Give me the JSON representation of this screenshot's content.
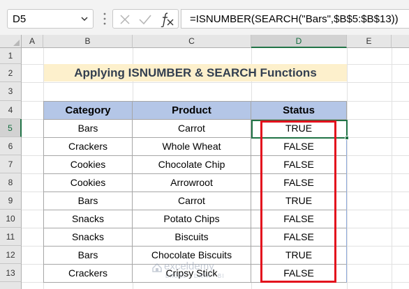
{
  "name_box": {
    "value": "D5"
  },
  "formula_bar": {
    "formula": "=ISNUMBER(SEARCH(\"Bars\",$B$5:$B$13))"
  },
  "columns": [
    "A",
    "B",
    "C",
    "D",
    "E"
  ],
  "rows": [
    "1",
    "2",
    "3",
    "4",
    "5",
    "6",
    "7",
    "8",
    "9",
    "10",
    "11",
    "12",
    "13"
  ],
  "selected": {
    "column": "D",
    "row": "5"
  },
  "sheet": {
    "title": "Applying ISNUMBER & SEARCH Functions",
    "headers": [
      "Category",
      "Product",
      "Status"
    ],
    "data": [
      [
        "Bars",
        "Carrot",
        "TRUE"
      ],
      [
        "Crackers",
        "Whole Wheat",
        "FALSE"
      ],
      [
        "Cookies",
        "Chocolate Chip",
        "FALSE"
      ],
      [
        "Cookies",
        "Arrowroot",
        "FALSE"
      ],
      [
        "Bars",
        "Carrot",
        "TRUE"
      ],
      [
        "Snacks",
        "Potato Chips",
        "FALSE"
      ],
      [
        "Snacks",
        "Biscuits",
        "FALSE"
      ],
      [
        "Bars",
        "Chocolate Biscuits",
        "TRUE"
      ],
      [
        "Crackers",
        "Cripsy Stick",
        "FALSE"
      ]
    ]
  },
  "watermark": {
    "name": "exceldemy",
    "tagline": "EXCEL · DATA · BI"
  },
  "colors": {
    "header_fill": "#b4c6e7",
    "title_fill": "#fdf0cc",
    "selection_green": "#217346",
    "highlight_red": "#e3101d"
  }
}
